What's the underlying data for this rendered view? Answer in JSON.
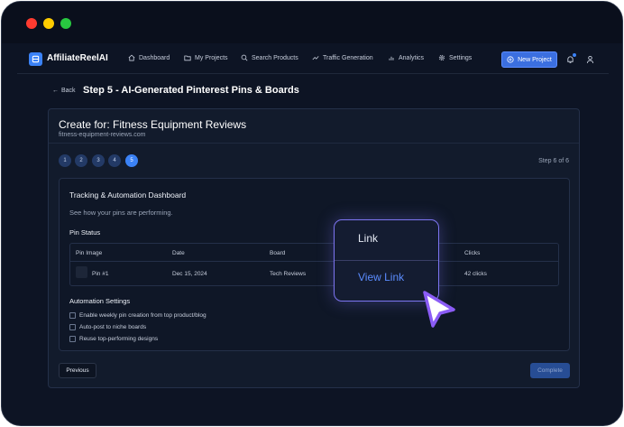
{
  "app": {
    "name": "AffiliateReelAI"
  },
  "nav": {
    "items": [
      {
        "label": "Dashboard",
        "icon": "home-icon"
      },
      {
        "label": "My Projects",
        "icon": "folder-icon"
      },
      {
        "label": "Search Products",
        "icon": "search-icon"
      },
      {
        "label": "Traffic Generation",
        "icon": "trend-icon"
      },
      {
        "label": "Analytics",
        "icon": "bar-chart-icon"
      },
      {
        "label": "Settings",
        "icon": "gear-icon"
      }
    ],
    "new_project_label": "New Project"
  },
  "page": {
    "back_label": "Back",
    "title": "Step 5 - AI-Generated Pinterest Pins & Boards"
  },
  "project": {
    "title": "Create for: Fitness Equipment Reviews",
    "domain": "fitness-equipment-reviews.com"
  },
  "steps": {
    "items": [
      "1",
      "2",
      "3",
      "4",
      "5"
    ],
    "active": "5",
    "counter": "Step 6 of 6"
  },
  "dashboard": {
    "title": "Tracking & Automation Dashboard",
    "subtitle": "See how your pins are performing.",
    "pin_status_title": "Pin Status",
    "columns": [
      "Pin Image",
      "Date",
      "Board",
      "Clicks"
    ],
    "rows": [
      {
        "pin": "Pin #1",
        "date": "Dec 15, 2024",
        "board": "Tech Reviews",
        "clicks": "42 clicks"
      }
    ],
    "automation_title": "Automation Settings",
    "automation_options": [
      "Enable weekly pin creation from top product/blog",
      "Auto-post to niche boards",
      "Reuse top-performing designs"
    ]
  },
  "footer": {
    "previous_label": "Previous",
    "complete_label": "Complete"
  },
  "popup": {
    "link_label": "Link",
    "view_link_label": "View Link"
  },
  "colors": {
    "accent": "#3b82f6",
    "popup_border": "#7c74f0",
    "link": "#5b8cff"
  }
}
